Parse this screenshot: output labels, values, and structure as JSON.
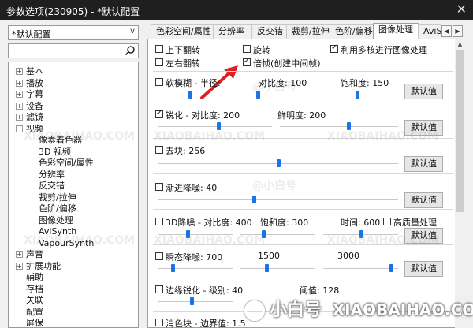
{
  "window": {
    "title": "参数选项(230905) - *默认配置",
    "close_glyph": "✕"
  },
  "left": {
    "preset_value": "*默认配置",
    "tree": [
      {
        "label": "基本",
        "level": 0,
        "expander": "+"
      },
      {
        "label": "播放",
        "level": 0,
        "expander": "+"
      },
      {
        "label": "字幕",
        "level": 0,
        "expander": "+"
      },
      {
        "label": "设备",
        "level": 0,
        "expander": "+"
      },
      {
        "label": "滤镜",
        "level": 0,
        "expander": "+"
      },
      {
        "label": "视频",
        "level": 0,
        "expander": "−"
      },
      {
        "label": "像素着色器",
        "level": 1
      },
      {
        "label": "3D 视频",
        "level": 1
      },
      {
        "label": "色彩空间/属性",
        "level": 1
      },
      {
        "label": "分辨率",
        "level": 1
      },
      {
        "label": "反交错",
        "level": 1
      },
      {
        "label": "裁剪/拉伸",
        "level": 1
      },
      {
        "label": "色阶/偏移",
        "level": 1
      },
      {
        "label": "图像处理",
        "level": 1
      },
      {
        "label": "AviSynth",
        "level": 1
      },
      {
        "label": "VapourSynth",
        "level": 1
      },
      {
        "label": "声音",
        "level": 0,
        "expander": "+"
      },
      {
        "label": "扩展功能",
        "level": 0,
        "expander": "+"
      },
      {
        "label": "辅助",
        "level": 0
      },
      {
        "label": "存档",
        "level": 0
      },
      {
        "label": "关联",
        "level": 0
      },
      {
        "label": "配置",
        "level": 0
      },
      {
        "label": "屏保",
        "level": 0
      }
    ]
  },
  "tabs": [
    "色彩空间/属性",
    "分辨率",
    "反交错",
    "裁剪/拉伸",
    "色阶/偏移",
    "图像处理",
    "AviS"
  ],
  "active_tab": "图像处理",
  "top_options": {
    "flip_vertical": {
      "label": "上下翻转",
      "checked": false
    },
    "rotate": {
      "label": "旋转",
      "checked": false
    },
    "multicore": {
      "label": "利用多核进行图像处理",
      "checked": true
    },
    "flip_horizontal": {
      "label": "左右翻转",
      "checked": false
    },
    "frame_double": {
      "label": "倍帧(创建中间帧)",
      "checked": true
    }
  },
  "soft_blur": {
    "label": "软模糊 - 半径:",
    "checked": false,
    "contrast_label": "对比度: 100",
    "saturation_label": "饱和度: 150",
    "radius_pos": 0.43,
    "contrast_pos": 0.23,
    "saturation_pos": 0.45
  },
  "sharpen": {
    "label": "锐化 - 对比度: 200",
    "checked": true,
    "brightness_label": "鲜明度: 200",
    "contrast_pos": 0.53,
    "brightness_pos": 0.58
  },
  "deblock": {
    "label": "去块: 256",
    "checked": false,
    "pos": 0.5
  },
  "progressive_denoise": {
    "label": "渐进降噪: 40",
    "checked": false,
    "pos": 0.4
  },
  "denoise3d": {
    "label": "3D降噪 - 对比度: 400",
    "checked": false,
    "saturation_label": "饱和度: 300",
    "time_label": "时间: 600",
    "hq_label": "高质量处理",
    "hq_checked": false,
    "contrast_pos": 0.4,
    "saturation_pos": 0.3,
    "time_pos": 0.5
  },
  "transient": {
    "label": "瞬态降噪: 700",
    "checked": false,
    "v2_label": "1500",
    "v3_label": "3000",
    "p1": 0.2,
    "p2": 0.35,
    "p3": 0.9
  },
  "edge": {
    "label": "边缘锐化 - 级别: 40",
    "checked": false,
    "threshold_label": "阈值: 128",
    "pos": 0.45
  },
  "eliminate": {
    "label": "消色块 - 边界值: 1.5",
    "checked": false
  },
  "buttons": {
    "default": "默认值"
  },
  "watermark": {
    "site": "XIAOBAIHAO.COM",
    "brand": "小白号",
    "brand_site": "XIAOBAIHAO.COM",
    "small": "@小白号"
  },
  "colors": {
    "accent": "#1a73e8",
    "arrow": "#e02020"
  }
}
